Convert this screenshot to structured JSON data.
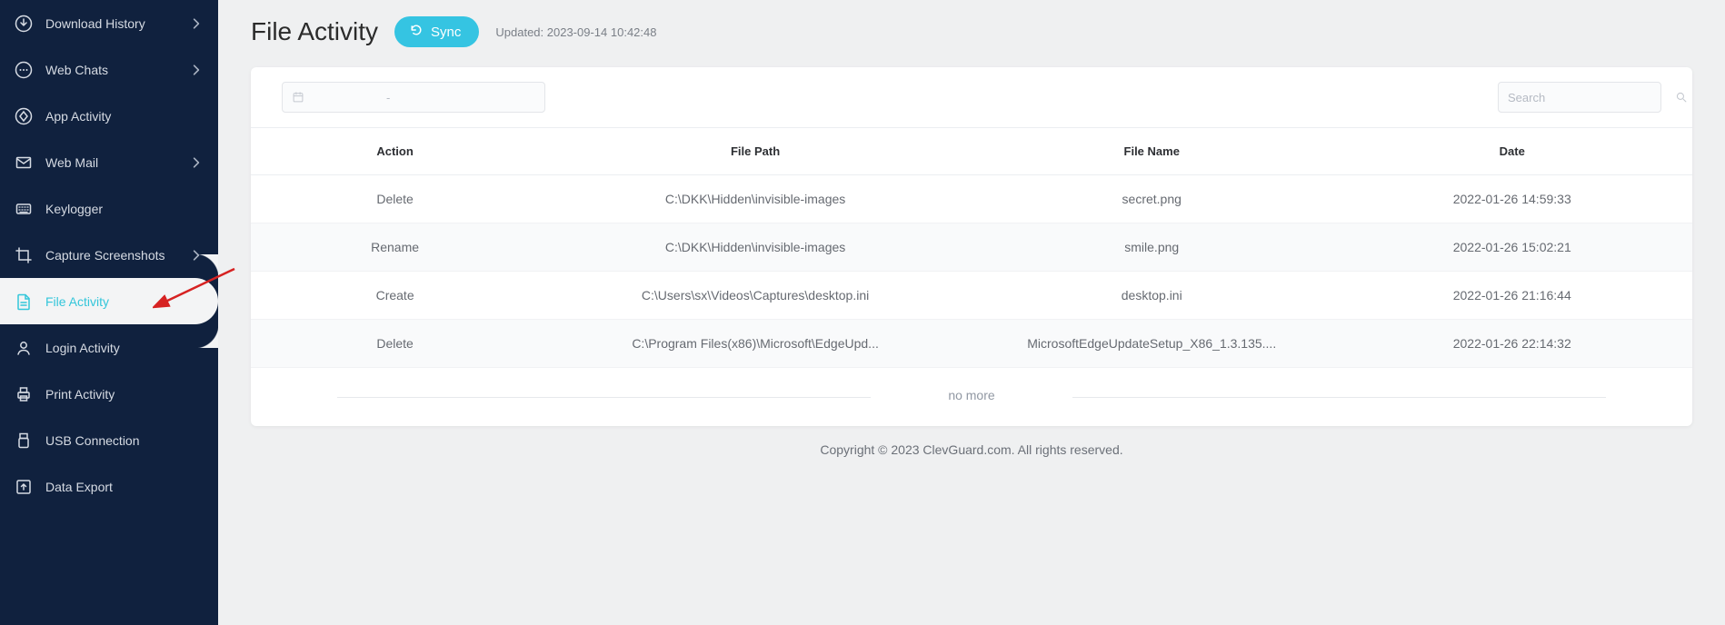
{
  "sidebar": {
    "items": [
      {
        "label": "Download History",
        "icon": "download-icon",
        "hasSub": true
      },
      {
        "label": "Web Chats",
        "icon": "chat-icon",
        "hasSub": true
      },
      {
        "label": "App Activity",
        "icon": "app-icon",
        "hasSub": false
      },
      {
        "label": "Web Mail",
        "icon": "mail-icon",
        "hasSub": true
      },
      {
        "label": "Keylogger",
        "icon": "keyboard-icon",
        "hasSub": false
      },
      {
        "label": "Capture Screenshots",
        "icon": "crop-icon",
        "hasSub": true
      },
      {
        "label": "File Activity",
        "icon": "file-icon",
        "hasSub": false,
        "active": true
      },
      {
        "label": "Login Activity",
        "icon": "user-icon",
        "hasSub": false
      },
      {
        "label": "Print Activity",
        "icon": "printer-icon",
        "hasSub": false
      },
      {
        "label": "USB Connection",
        "icon": "usb-icon",
        "hasSub": false
      },
      {
        "label": "Data Export",
        "icon": "export-icon",
        "hasSub": false
      }
    ]
  },
  "header": {
    "title": "File Activity",
    "sync_label": "Sync",
    "updated_label": "Updated: 2023-09-14 10:42:48"
  },
  "toolbar": {
    "date_placeholder": "-",
    "search_placeholder": "Search"
  },
  "table": {
    "columns": [
      "Action",
      "File Path",
      "File Name",
      "Date"
    ],
    "rows": [
      {
        "action": "Delete",
        "path": "C:\\DKK\\Hidden\\invisible-images",
        "name": "secret.png",
        "date": "2022-01-26 14:59:33"
      },
      {
        "action": "Rename",
        "path": "C:\\DKK\\Hidden\\invisible-images",
        "name": "smile.png",
        "date": "2022-01-26 15:02:21"
      },
      {
        "action": "Create",
        "path": "C:\\Users\\sx\\Videos\\Captures\\desktop.ini",
        "name": "desktop.ini",
        "date": "2022-01-26 21:16:44"
      },
      {
        "action": "Delete",
        "path": "C:\\Program Files(x86)\\Microsoft\\EdgeUpd...",
        "name": "MicrosoftEdgeUpdateSetup_X86_1.3.135....",
        "date": "2022-01-26 22:14:32"
      }
    ],
    "no_more": "no more"
  },
  "footer": {
    "copyright": "Copyright © 2023 ClevGuard.com. All rights reserved."
  }
}
